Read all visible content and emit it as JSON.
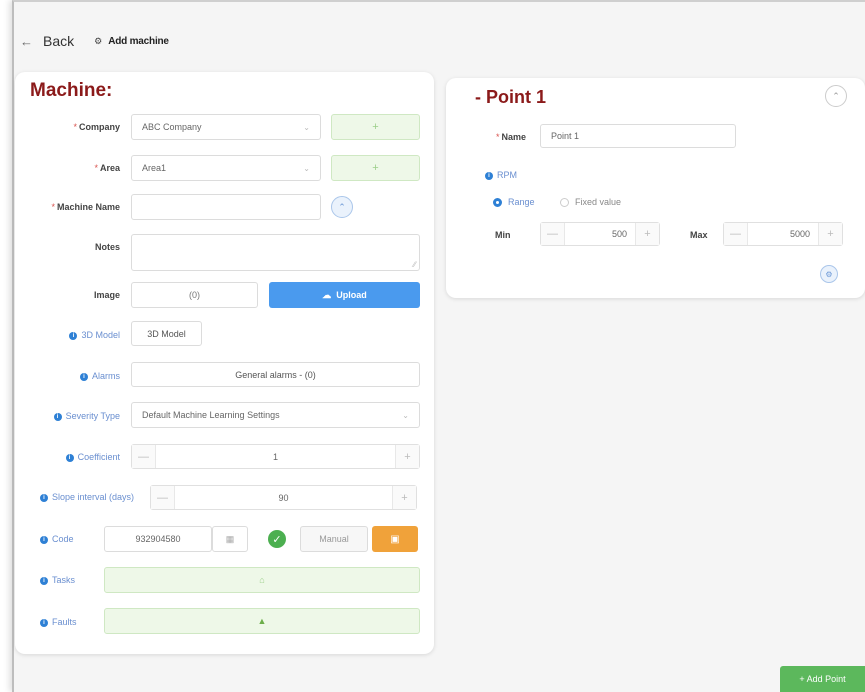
{
  "header": {
    "back_label": "Back",
    "breadcrumb": "Add machine"
  },
  "machine": {
    "title": "Machine:",
    "company": {
      "label": "Company",
      "value": "ABC Company"
    },
    "area": {
      "label": "Area",
      "value": "Area1"
    },
    "machine_name": {
      "label": "Machine Name",
      "value": ""
    },
    "notes": {
      "label": "Notes",
      "value": ""
    },
    "image": {
      "label": "Image",
      "count": "(0)",
      "upload_label": "Upload"
    },
    "model3d": {
      "label": "3D Model",
      "button": "3D Model"
    },
    "alarms": {
      "label": "Alarms",
      "value": "General alarms - (0)"
    },
    "severity": {
      "label": "Severity Type",
      "value": "Default Machine Learning Settings"
    },
    "coefficient": {
      "label": "Coefficient",
      "value": "1"
    },
    "slope": {
      "label": "Slope interval (days)",
      "value": "90"
    },
    "code": {
      "label": "Code",
      "value": "932904580",
      "manual_label": "Manual"
    },
    "tasks": {
      "label": "Tasks"
    },
    "faults": {
      "label": "Faults"
    }
  },
  "point": {
    "title": "- Point 1",
    "name": {
      "label": "Name",
      "value": "Point 1"
    },
    "rpm_label": "RPM",
    "range_label": "Range",
    "fixed_label": "Fixed value",
    "min": {
      "label": "Min",
      "value": "500"
    },
    "max": {
      "label": "Max",
      "value": "5000"
    }
  },
  "add_point_label": "+ Add Point",
  "colors": {
    "title": "#8b1a1a",
    "primary_blue": "#4a9aee",
    "success_green": "#5cb85c",
    "warning_orange": "#f0a23a"
  }
}
